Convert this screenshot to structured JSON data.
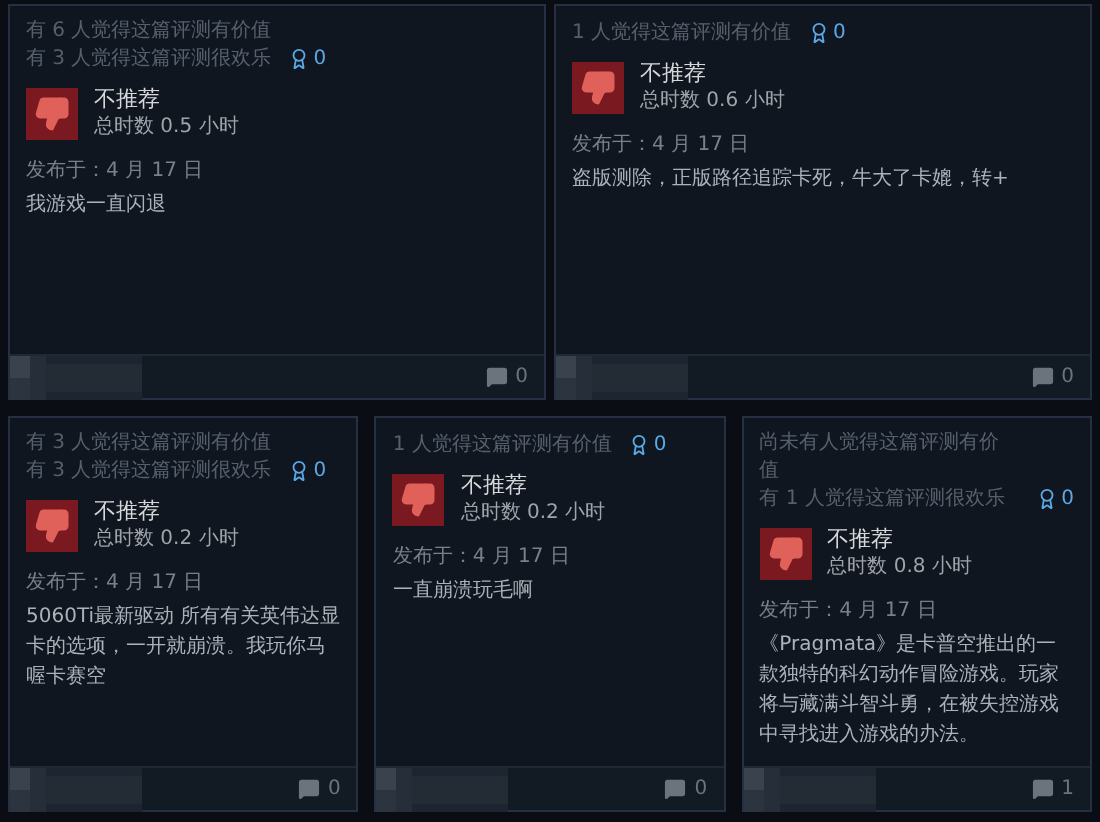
{
  "reviews": [
    {
      "helpful": [
        "有 6 人觉得这篇评测有价值",
        "有 3 人觉得这篇评测很欢乐"
      ],
      "awards": "0",
      "recommended": false,
      "verdict": "不推荐",
      "hours": "总时数 0.5 小时",
      "posted": "发布于：4 月 17 日",
      "text": "我游戏一直闪退",
      "comments": "0"
    },
    {
      "helpful": [
        "1 人觉得这篇评测有价值"
      ],
      "awards": "0",
      "recommended": false,
      "verdict": "不推荐",
      "hours": "总时数 0.6 小时",
      "posted": "发布于：4 月 17 日",
      "text": "盗版测除，正版路径追踪卡死，牛大了卡媲，转+",
      "comments": "0"
    },
    {
      "helpful": [
        "有 3 人觉得这篇评测有价值",
        "有 3 人觉得这篇评测很欢乐"
      ],
      "awards": "0",
      "recommended": false,
      "verdict": "不推荐",
      "hours": "总时数 0.2 小时",
      "posted": "发布于：4 月 17 日",
      "text": "5060Ti最新驱动 所有有关英伟达显卡的选项，一开就崩溃。我玩你马喔卡赛空",
      "comments": "0"
    },
    {
      "helpful": [
        "1 人觉得这篇评测有价值"
      ],
      "awards": "0",
      "recommended": false,
      "verdict": "不推荐",
      "hours": "总时数 0.2 小时",
      "posted": "发布于：4 月 17 日",
      "text": "一直崩溃玩毛啊",
      "comments": "0"
    },
    {
      "helpful": [
        "尚未有人觉得这篇评测有价值",
        "有 1 人觉得这篇评测很欢乐"
      ],
      "awards": "0",
      "recommended": false,
      "verdict": "不推荐",
      "hours": "总时数 0.8 小时",
      "posted": "发布于：4 月 17 日",
      "text": "《Pragmata》是卡普空推出的一款独特的科幻动作冒险游戏。玩家将与藏满斗智斗勇，在被失控游戏中寻找进入游戏的办法。",
      "comments": "1"
    }
  ]
}
